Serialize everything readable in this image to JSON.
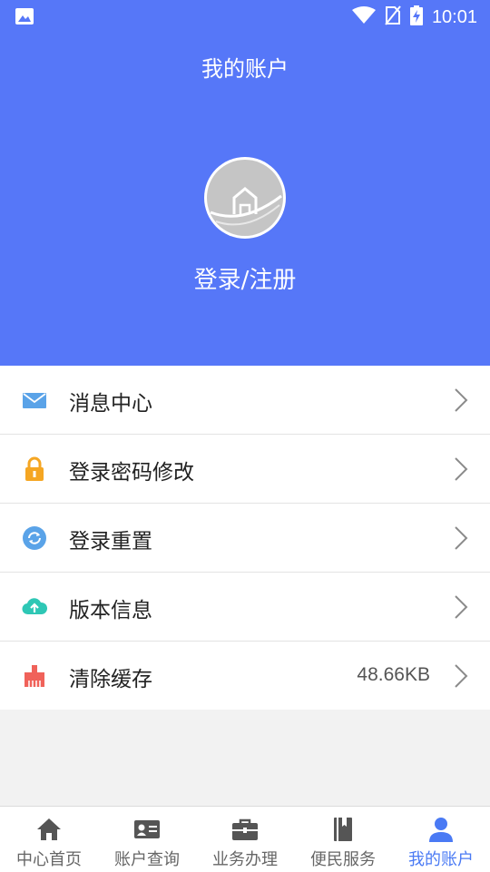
{
  "status_bar": {
    "time": "10:01"
  },
  "header": {
    "title": "我的账户",
    "login_label": "登录/注册"
  },
  "menu": [
    {
      "label": "消息中心",
      "icon": "mail-icon",
      "value": ""
    },
    {
      "label": "登录密码修改",
      "icon": "lock-icon",
      "value": ""
    },
    {
      "label": "登录重置",
      "icon": "refresh-icon",
      "value": ""
    },
    {
      "label": "版本信息",
      "icon": "cloud-upload-icon",
      "value": ""
    },
    {
      "label": "清除缓存",
      "icon": "broom-icon",
      "value": "48.66KB"
    }
  ],
  "tabbar": {
    "active": 4,
    "items": [
      {
        "label": "中心首页",
        "icon": "home-icon"
      },
      {
        "label": "账户查询",
        "icon": "id-card-icon"
      },
      {
        "label": "业务办理",
        "icon": "briefcase-icon"
      },
      {
        "label": "便民服务",
        "icon": "book-icon"
      },
      {
        "label": "我的账户",
        "icon": "user-icon"
      }
    ]
  },
  "colors": {
    "header_bg": "#5677f8",
    "active_tab": "#4a7af4",
    "mail": "#5aa3e8",
    "lock": "#f5a623",
    "refresh": "#5aa3e8",
    "cloud": "#2ec7b5",
    "broom": "#f0625a"
  }
}
